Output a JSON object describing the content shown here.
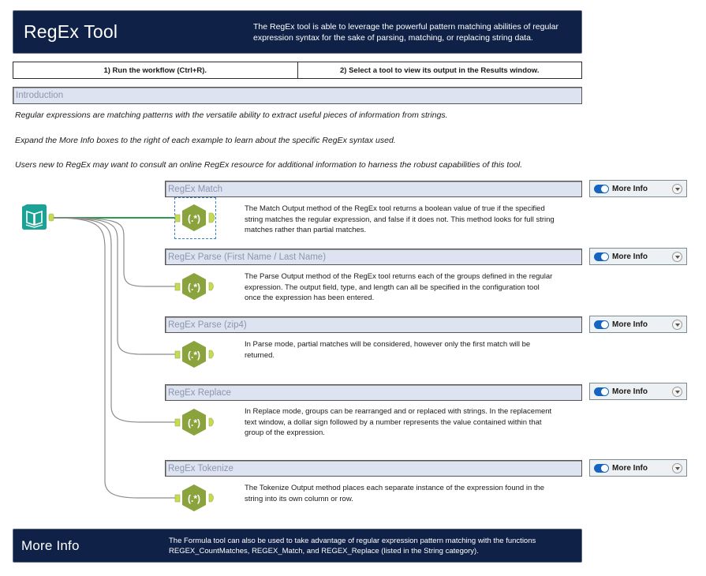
{
  "header": {
    "title": "RegEx Tool",
    "description_line1": "The RegEx tool is able to leverage the powerful pattern matching abilities of regular",
    "description_line2": "expression syntax for the sake of parsing, matching, or replacing string data."
  },
  "steps": [
    {
      "label": "1) Run the workflow (Ctrl+R)."
    },
    {
      "label": "2) Select a tool to view its output in the Results window."
    }
  ],
  "introduction": {
    "header": "Introduction",
    "lines": [
      "Regular expressions are matching patterns with the versatile ability to extract useful pieces of information from strings.",
      "Expand the More Info boxes to the right of each example to learn about the specific RegEx syntax used.",
      "Users new to RegEx may want to consult an online RegEx resource for additional information to harness the robust capabilities of this tool."
    ]
  },
  "input_tool": {
    "icon": "book-icon",
    "color": "#1aa394"
  },
  "regex_tool": {
    "icon": "regex-hexagon-icon",
    "glyph": "(.*)",
    "color": "#8aa33d"
  },
  "examples": [
    {
      "title": "RegEx Match",
      "lines": [
        "The Match Output method of the RegEx tool returns a boolean value of true if the specified",
        "string matches the regular expression, and false if it does not. This method looks for full string",
        "matches rather than partial matches."
      ],
      "more_info": "More Info",
      "selected": true
    },
    {
      "title": "RegEx Parse (First Name / Last Name)",
      "lines": [
        "The Parse Output method of the RegEx tool returns each of the groups defined in the regular",
        "expression. The output field, type, and length can all be specified in the configuration tool",
        "once the expression has been entered."
      ],
      "more_info": "More Info",
      "selected": false
    },
    {
      "title": "RegEx Parse (zip4)",
      "lines": [
        "In Parse mode, partial matches will be considered, however only the first match will be",
        "returned."
      ],
      "more_info": "More Info",
      "selected": false
    },
    {
      "title": "RegEx Replace",
      "lines": [
        "In Replace mode, groups can be rearranged and or replaced with strings. In the replacement",
        "text window, a dollar sign followed by a number represents the value contained within that",
        "group of the expression."
      ],
      "more_info": "More Info",
      "selected": false
    },
    {
      "title": "RegEx Tokenize",
      "lines": [
        "The Tokenize Output method places each separate instance of the expression found in the",
        "string into its own column or row."
      ],
      "more_info": "More Info",
      "selected": false
    }
  ],
  "footer": {
    "title": "More Info",
    "description_line1": "The Formula tool can also be used to take advantage of regular expression pattern matching with the functions",
    "description_line2": "REGEX_CountMatches, REGEX_Match, and REGEX_Replace (listed in the String category)."
  }
}
